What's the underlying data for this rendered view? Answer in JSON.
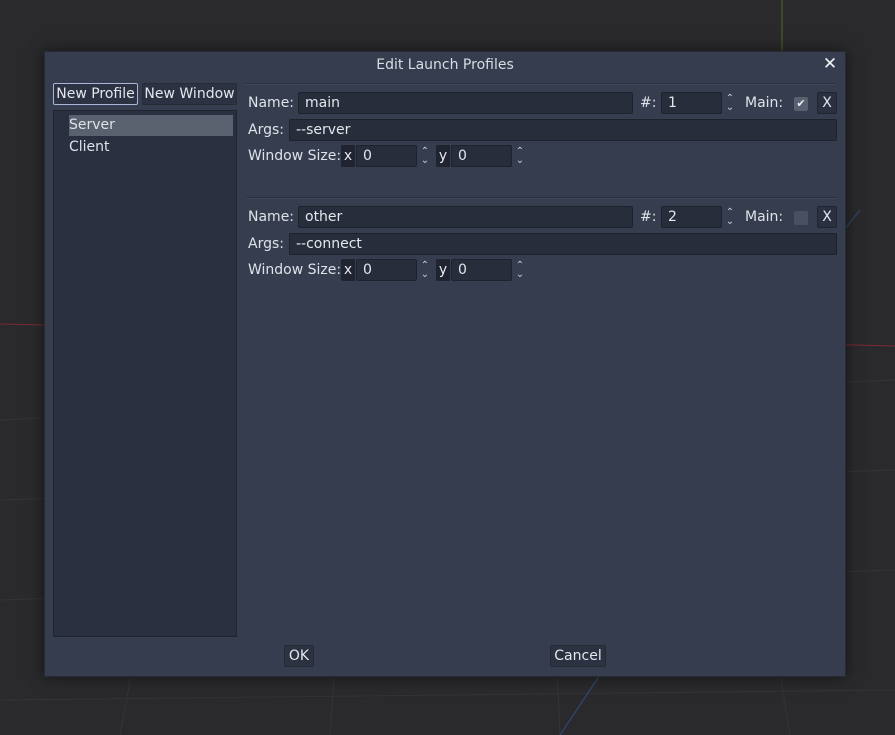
{
  "dialog": {
    "title": "Edit Launch Profiles",
    "close_label": "✕",
    "new_profile_label": "New Profile",
    "new_window_label": "New Window",
    "ok_label": "OK",
    "cancel_label": "Cancel"
  },
  "profiles": [
    {
      "label": "Server",
      "selected": true
    },
    {
      "label": "Client",
      "selected": false
    }
  ],
  "windows": [
    {
      "name_label": "Name:",
      "name_value": "main",
      "count_label": "#:",
      "count_value": "1",
      "main_label": "Main:",
      "main_checked": true,
      "remove_label": "X",
      "args_label": "Args:",
      "args_value": "--server",
      "size_label": "Window Size:",
      "x_label": "x",
      "x_value": "0",
      "y_label": "y",
      "y_value": "0"
    },
    {
      "name_label": "Name:",
      "name_value": "other",
      "count_label": "#:",
      "count_value": "2",
      "main_label": "Main:",
      "main_checked": false,
      "remove_label": "X",
      "args_label": "Args:",
      "args_value": "--connect",
      "size_label": "Window Size:",
      "x_label": "x",
      "x_value": "0",
      "y_label": "y",
      "y_value": "0"
    }
  ],
  "icons": {
    "checkmark": "✔",
    "spin_up": "⌃",
    "spin_down": "⌄"
  }
}
